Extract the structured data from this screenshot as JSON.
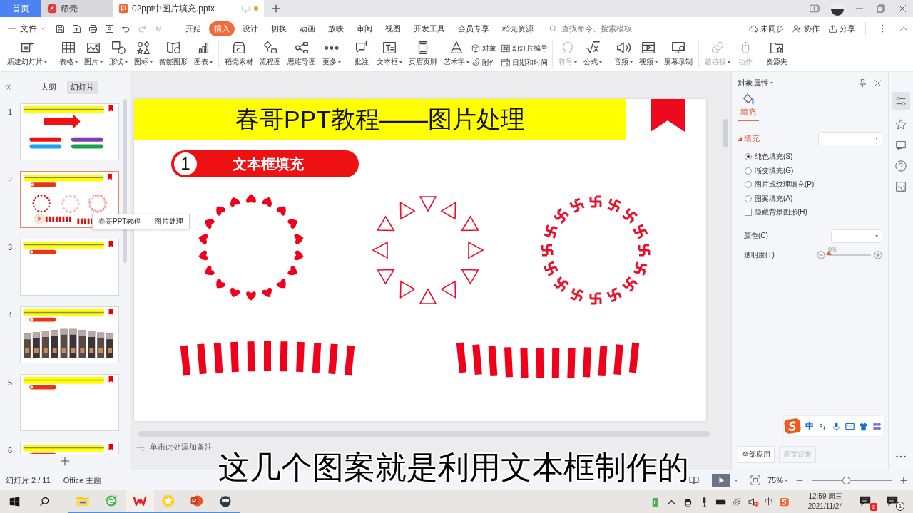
{
  "tabs": [
    {
      "label": "首页",
      "kind": "home",
      "selected": false
    },
    {
      "label": "稻壳",
      "kind": "app",
      "selected": false
    },
    {
      "label": "02ppt中图片填充.pptx",
      "kind": "doc",
      "selected": true,
      "unsaved": true
    }
  ],
  "menu": {
    "file": "文件",
    "items": [
      {
        "label": "开始",
        "selected": false
      },
      {
        "label": "插入",
        "selected": true
      },
      {
        "label": "设计",
        "selected": false
      },
      {
        "label": "切换",
        "selected": false
      },
      {
        "label": "动画",
        "selected": false
      },
      {
        "label": "放映",
        "selected": false
      },
      {
        "label": "审阅",
        "selected": false
      },
      {
        "label": "视图",
        "selected": false
      },
      {
        "label": "开发工具",
        "selected": false
      },
      {
        "label": "会员专享",
        "selected": false
      },
      {
        "label": "稻壳资源",
        "selected": false
      }
    ],
    "search_placeholder": "查找命令、搜索模板",
    "actions": [
      "未同步",
      "协作",
      "分享"
    ]
  },
  "ribbon": [
    {
      "kind": "large",
      "items": [
        {
          "label": "新建幻灯片",
          "dropdown": true,
          "disabled": false
        }
      ]
    },
    {
      "kind": "large",
      "items": [
        {
          "label": "表格",
          "dropdown": true,
          "disabled": false
        },
        {
          "label": "图片",
          "dropdown": true,
          "disabled": false
        },
        {
          "label": "形状",
          "dropdown": true,
          "disabled": false
        },
        {
          "label": "图标",
          "dropdown": true,
          "disabled": false
        },
        {
          "label": "智能图形",
          "dropdown": false,
          "disabled": false
        },
        {
          "label": "图表",
          "dropdown": true,
          "disabled": false
        }
      ]
    },
    {
      "kind": "large",
      "items": [
        {
          "label": "稻壳素材",
          "dropdown": false,
          "disabled": false
        },
        {
          "label": "流程图",
          "dropdown": false,
          "disabled": false
        },
        {
          "label": "思维导图",
          "dropdown": false,
          "disabled": false
        },
        {
          "label": "更多",
          "dropdown": true,
          "disabled": false
        }
      ]
    },
    {
      "kind": "large",
      "items": [
        {
          "label": "批注",
          "dropdown": false,
          "disabled": false
        },
        {
          "label": "文本框",
          "dropdown": true,
          "disabled": false
        },
        {
          "label": "页眉页脚",
          "dropdown": false,
          "disabled": false
        },
        {
          "label": "艺术字",
          "dropdown": true,
          "disabled": false
        }
      ]
    },
    {
      "kind": "small",
      "items": [
        {
          "label": "对象",
          "dropdown": false,
          "disabled": false
        },
        {
          "label": "附件",
          "dropdown": false,
          "disabled": false
        },
        {
          "label": "幻灯片编号",
          "dropdown": false,
          "disabled": false
        },
        {
          "label": "日期和时间",
          "dropdown": false,
          "disabled": false
        }
      ]
    },
    {
      "kind": "large",
      "items": [
        {
          "label": "符号",
          "dropdown": true,
          "disabled": true
        },
        {
          "label": "公式",
          "dropdown": true,
          "disabled": false
        }
      ]
    },
    {
      "kind": "large",
      "items": [
        {
          "label": "音频",
          "dropdown": true,
          "disabled": false
        },
        {
          "label": "视频",
          "dropdown": true,
          "disabled": false
        },
        {
          "label": "屏幕录制",
          "dropdown": false,
          "disabled": false
        }
      ]
    },
    {
      "kind": "large",
      "items": [
        {
          "label": "超链接",
          "dropdown": true,
          "disabled": true
        },
        {
          "label": "动作",
          "dropdown": false,
          "disabled": true
        }
      ]
    },
    {
      "kind": "large",
      "items": [
        {
          "label": "资源夹",
          "dropdown": false,
          "disabled": false
        }
      ]
    }
  ],
  "pane": {
    "tabs": [
      {
        "label": "大纲",
        "selected": false
      },
      {
        "label": "幻灯片",
        "selected": true
      }
    ],
    "slides": [
      {
        "number": "1",
        "kind": "arrow",
        "selected": false
      },
      {
        "number": "2",
        "kind": "patterns",
        "selected": true
      },
      {
        "number": "3",
        "kind": "blank",
        "selected": false
      },
      {
        "number": "4",
        "kind": "photos",
        "selected": false
      },
      {
        "number": "5",
        "kind": "blank",
        "selected": false
      },
      {
        "number": "6",
        "kind": "blank",
        "selected": false
      }
    ],
    "tooltip": "春哥PPT教程——图片处理"
  },
  "slide": {
    "title": "春哥PPT教程——图片处理",
    "badge_number": "1",
    "badge_text": "文本框填充",
    "patterns": [
      {
        "kind": "hearts"
      },
      {
        "kind": "triangles"
      },
      {
        "kind": "crosses"
      },
      {
        "kind": "bars-arch"
      },
      {
        "kind": "bars-sag"
      }
    ]
  },
  "notes_placeholder": "单击此处添加备注",
  "properties": {
    "title": "对象属性",
    "tabs": [
      {
        "label": "填充",
        "selected": true
      }
    ],
    "section": {
      "label": "填充",
      "expanded": true
    },
    "options": [
      {
        "kind": "radio",
        "label": "纯色填充(S)",
        "selected": true
      },
      {
        "kind": "radio",
        "label": "渐变填充(G)",
        "selected": false
      },
      {
        "kind": "radio",
        "label": "图片或纹理填充(P)",
        "selected": false
      },
      {
        "kind": "radio",
        "label": "图案填充(A)",
        "selected": false
      },
      {
        "kind": "checkbox",
        "label": "隐藏背景图形(H)",
        "checked": false
      }
    ],
    "color_label": "颜色(C)",
    "transparency": {
      "label": "透明度(T)",
      "reading": "0%",
      "level": 0
    },
    "buttons": [
      {
        "label": "全部应用",
        "disabled": false
      },
      {
        "label": "重置背景",
        "disabled": true
      }
    ]
  },
  "ime_toolbar": {
    "mode": "中"
  },
  "status": {
    "slide": "幻灯片 2 / 11",
    "theme": "Office 主题",
    "zoom": "75%",
    "zoom_slider": {
      "level": 0.43
    }
  },
  "subtitle": "这几个图案就是利用文本框制作的",
  "tray": {
    "ime": "中",
    "time": "12:59 周三",
    "date": "2021/11/24",
    "notifications": [
      {
        "badge": "2"
      },
      {
        "badge": "1"
      }
    ]
  }
}
